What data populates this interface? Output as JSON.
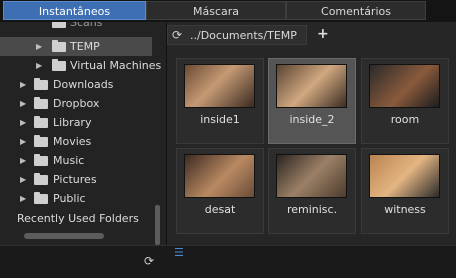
{
  "tabs": [
    {
      "label": "Instantâneos",
      "active": true
    },
    {
      "label": "Máscara",
      "active": false
    },
    {
      "label": "Comentários",
      "active": false
    }
  ],
  "tree": {
    "partial_item": "Scans",
    "items": [
      {
        "label": "TEMP",
        "selected": true
      },
      {
        "label": "Virtual Machines"
      },
      {
        "label": "Downloads"
      },
      {
        "label": "Dropbox"
      },
      {
        "label": "Library"
      },
      {
        "label": "Movies"
      },
      {
        "label": "Music"
      },
      {
        "label": "Pictures"
      },
      {
        "label": "Public"
      }
    ],
    "recent_label": "Recently Used Folders"
  },
  "browser": {
    "path": "../Documents/TEMP",
    "add_tab": "+",
    "thumbnails": [
      {
        "label": "inside1",
        "selected": false
      },
      {
        "label": "inside_2",
        "selected": true
      },
      {
        "label": "room",
        "selected": false
      },
      {
        "label": "desat",
        "selected": false
      },
      {
        "label": "reminisc.",
        "selected": false
      },
      {
        "label": "witness",
        "selected": false
      }
    ]
  },
  "icons": {
    "refresh": "refresh-icon",
    "folder": "folder-icon",
    "expand": "expand-arrow-icon",
    "list": "list-view-icon"
  },
  "colors": {
    "active_tab": "#3d6fb2",
    "selection": "#555555"
  }
}
